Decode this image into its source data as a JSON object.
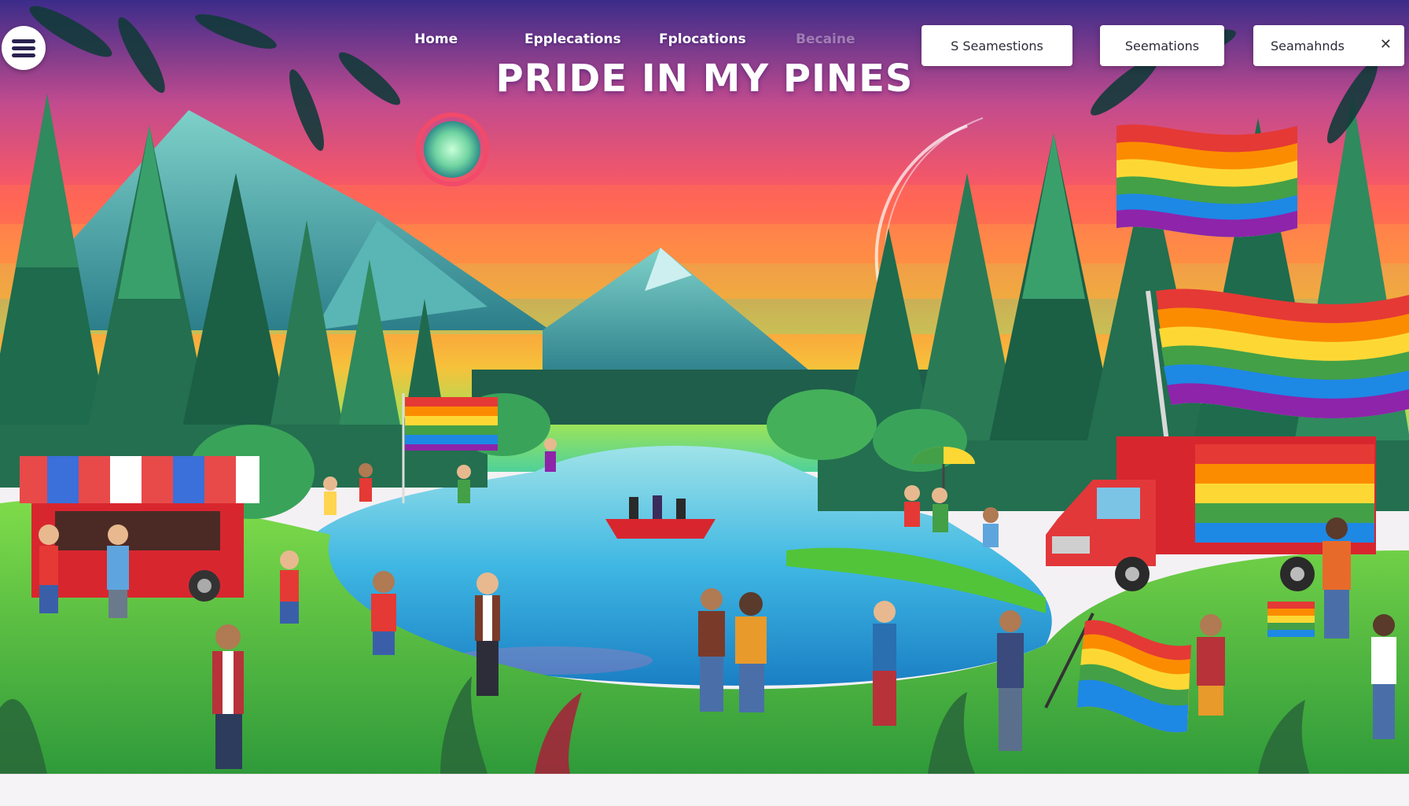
{
  "header": {
    "title": "PRIDE IN MY PINES",
    "menu_icon": "hamburger-menu-icon",
    "nav": [
      {
        "label": "Home"
      },
      {
        "label": "Epplecations"
      },
      {
        "label": "Fplocations"
      },
      {
        "label": "Becaine"
      }
    ]
  },
  "search": {
    "box1": "S Seamestions",
    "box2": "Seemations",
    "box3": "Seamahnds",
    "close_icon": "close-icon"
  },
  "colors": {
    "sky_top": "#3b2c8a",
    "sky_mid": "#ff5a5f",
    "sky_low": "#f6c23b",
    "pine": "#1f6a4e",
    "lake": "#3fb7e3",
    "grass": "#5fcf3c",
    "truck_red": "#d8262f"
  },
  "rainbow": [
    "#e53935",
    "#fb8c00",
    "#fdd835",
    "#43a047",
    "#1e88e5",
    "#8e24aa"
  ]
}
